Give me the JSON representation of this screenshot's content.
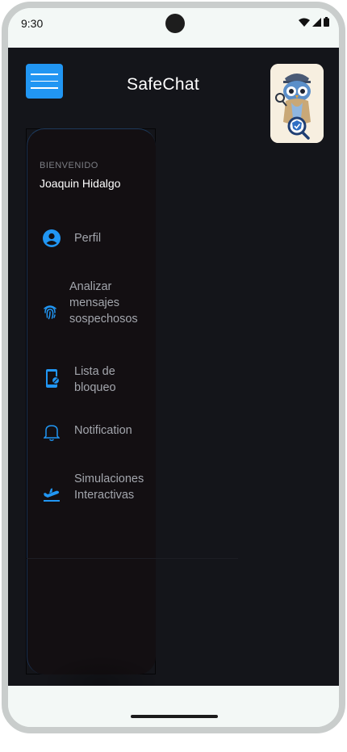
{
  "status_bar": {
    "time": "9:30"
  },
  "header": {
    "title": "SafeChat",
    "menu_icon": "hamburger-menu-icon",
    "logo_icon": "owl-detective-shield-logo"
  },
  "drawer": {
    "welcome_label": "BIENVENIDO",
    "user_name": "Joaquin Hidalgo",
    "items": [
      {
        "label": "Perfil",
        "icon": "account-circle-icon"
      },
      {
        "label": "Analizar mensajes sospechosos",
        "icon": "fingerprint-icon"
      },
      {
        "label": "Lista de bloqueo",
        "icon": "phone-block-icon"
      },
      {
        "label": "Notification",
        "icon": "bell-icon"
      },
      {
        "label": "Simulaciones Interactivas",
        "icon": "flight-takeoff-icon"
      }
    ]
  },
  "colors": {
    "accent": "#2196f3",
    "background": "#14151a",
    "drawer": "#130f12",
    "label": "#a3a6ad"
  }
}
